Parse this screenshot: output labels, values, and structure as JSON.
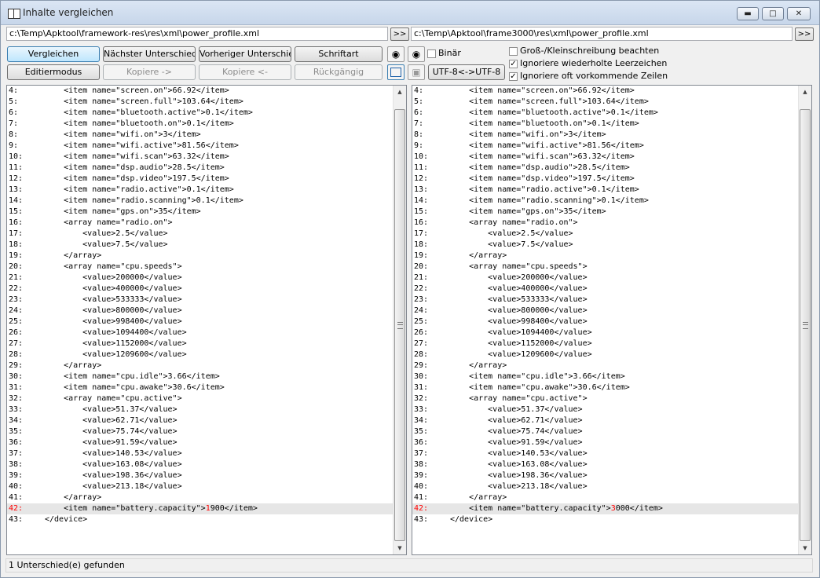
{
  "window": {
    "title": "Inhalte vergleichen"
  },
  "paths": {
    "left": "c:\\Temp\\Apktool\\framework-res\\res\\xml\\power_profile.xml",
    "right": "c:\\Temp\\Apktool\\frame3000\\res\\xml\\power_profile.xml",
    "browse_label": ">>"
  },
  "toolbar": {
    "compare": "Vergleichen",
    "next_diff": "Nächster Unterschied",
    "prev_diff": "Vorheriger Unterschied",
    "font": "Schriftart",
    "edit_mode": "Editiermodus",
    "copy_right": "Kopiere ->",
    "copy_left": "Kopiere <-",
    "undo": "Rückgängig",
    "encoding": "UTF-8<->UTF-8",
    "binary": "Binär",
    "case_sensitive": "Groß-/Kleinschreibung beachten",
    "ignore_repeated_spaces": "Ignoriere wiederholte Leerzeichen",
    "ignore_frequent_lines": "Ignoriere oft vorkommende Zeilen"
  },
  "options": {
    "binary": false,
    "case_sensitive": false,
    "ignore_repeated_spaces": true,
    "ignore_frequent_lines": true
  },
  "left_lines": [
    {
      "n": "4:",
      "t": "    <item name=\"screen.on\">66.92</item>"
    },
    {
      "n": "5:",
      "t": "    <item name=\"screen.full\">103.64</item>"
    },
    {
      "n": "6:",
      "t": "    <item name=\"bluetooth.active\">0.1</item>"
    },
    {
      "n": "7:",
      "t": "    <item name=\"bluetooth.on\">0.1</item>"
    },
    {
      "n": "8:",
      "t": "    <item name=\"wifi.on\">3</item>"
    },
    {
      "n": "9:",
      "t": "    <item name=\"wifi.active\">81.56</item>"
    },
    {
      "n": "10:",
      "t": "    <item name=\"wifi.scan\">63.32</item>"
    },
    {
      "n": "11:",
      "t": "    <item name=\"dsp.audio\">28.5</item>"
    },
    {
      "n": "12:",
      "t": "    <item name=\"dsp.video\">197.5</item>"
    },
    {
      "n": "13:",
      "t": "    <item name=\"radio.active\">0.1</item>"
    },
    {
      "n": "14:",
      "t": "    <item name=\"radio.scanning\">0.1</item>"
    },
    {
      "n": "15:",
      "t": "    <item name=\"gps.on\">35</item>"
    },
    {
      "n": "16:",
      "t": "    <array name=\"radio.on\">"
    },
    {
      "n": "17:",
      "t": "        <value>2.5</value>"
    },
    {
      "n": "18:",
      "t": "        <value>7.5</value>"
    },
    {
      "n": "19:",
      "t": "    </array>"
    },
    {
      "n": "20:",
      "t": "    <array name=\"cpu.speeds\">"
    },
    {
      "n": "21:",
      "t": "        <value>200000</value>"
    },
    {
      "n": "22:",
      "t": "        <value>400000</value>"
    },
    {
      "n": "23:",
      "t": "        <value>533333</value>"
    },
    {
      "n": "24:",
      "t": "        <value>800000</value>"
    },
    {
      "n": "25:",
      "t": "        <value>998400</value>"
    },
    {
      "n": "26:",
      "t": "        <value>1094400</value>"
    },
    {
      "n": "27:",
      "t": "        <value>1152000</value>"
    },
    {
      "n": "28:",
      "t": "        <value>1209600</value>"
    },
    {
      "n": "29:",
      "t": "    </array>"
    },
    {
      "n": "30:",
      "t": "    <item name=\"cpu.idle\">3.66</item>"
    },
    {
      "n": "31:",
      "t": "    <item name=\"cpu.awake\">30.6</item>"
    },
    {
      "n": "32:",
      "t": "    <array name=\"cpu.active\">"
    },
    {
      "n": "33:",
      "t": "        <value>51.37</value>"
    },
    {
      "n": "34:",
      "t": "        <value>62.71</value>"
    },
    {
      "n": "35:",
      "t": "        <value>75.74</value>"
    },
    {
      "n": "36:",
      "t": "        <value>91.59</value>"
    },
    {
      "n": "37:",
      "t": "        <value>140.53</value>"
    },
    {
      "n": "38:",
      "t": "        <value>163.08</value>"
    },
    {
      "n": "39:",
      "t": "        <value>198.36</value>"
    },
    {
      "n": "40:",
      "t": "        <value>213.18</value>"
    },
    {
      "n": "41:",
      "t": "    </array>"
    },
    {
      "n": "42:",
      "t": "    <item name=\"battery.capacity\">",
      "d": "1",
      "r": "900</item>",
      "hl": true
    },
    {
      "n": "43:",
      "t": "</device>"
    }
  ],
  "right_lines": [
    {
      "n": "4:",
      "t": "    <item name=\"screen.on\">66.92</item>"
    },
    {
      "n": "5:",
      "t": "    <item name=\"screen.full\">103.64</item>"
    },
    {
      "n": "6:",
      "t": "    <item name=\"bluetooth.active\">0.1</item>"
    },
    {
      "n": "7:",
      "t": "    <item name=\"bluetooth.on\">0.1</item>"
    },
    {
      "n": "8:",
      "t": "    <item name=\"wifi.on\">3</item>"
    },
    {
      "n": "9:",
      "t": "    <item name=\"wifi.active\">81.56</item>"
    },
    {
      "n": "10:",
      "t": "    <item name=\"wifi.scan\">63.32</item>"
    },
    {
      "n": "11:",
      "t": "    <item name=\"dsp.audio\">28.5</item>"
    },
    {
      "n": "12:",
      "t": "    <item name=\"dsp.video\">197.5</item>"
    },
    {
      "n": "13:",
      "t": "    <item name=\"radio.active\">0.1</item>"
    },
    {
      "n": "14:",
      "t": "    <item name=\"radio.scanning\">0.1</item>"
    },
    {
      "n": "15:",
      "t": "    <item name=\"gps.on\">35</item>"
    },
    {
      "n": "16:",
      "t": "    <array name=\"radio.on\">"
    },
    {
      "n": "17:",
      "t": "        <value>2.5</value>"
    },
    {
      "n": "18:",
      "t": "        <value>7.5</value>"
    },
    {
      "n": "19:",
      "t": "    </array>"
    },
    {
      "n": "20:",
      "t": "    <array name=\"cpu.speeds\">"
    },
    {
      "n": "21:",
      "t": "        <value>200000</value>"
    },
    {
      "n": "22:",
      "t": "        <value>400000</value>"
    },
    {
      "n": "23:",
      "t": "        <value>533333</value>"
    },
    {
      "n": "24:",
      "t": "        <value>800000</value>"
    },
    {
      "n": "25:",
      "t": "        <value>998400</value>"
    },
    {
      "n": "26:",
      "t": "        <value>1094400</value>"
    },
    {
      "n": "27:",
      "t": "        <value>1152000</value>"
    },
    {
      "n": "28:",
      "t": "        <value>1209600</value>"
    },
    {
      "n": "29:",
      "t": "    </array>"
    },
    {
      "n": "30:",
      "t": "    <item name=\"cpu.idle\">3.66</item>"
    },
    {
      "n": "31:",
      "t": "    <item name=\"cpu.awake\">30.6</item>"
    },
    {
      "n": "32:",
      "t": "    <array name=\"cpu.active\">"
    },
    {
      "n": "33:",
      "t": "        <value>51.37</value>"
    },
    {
      "n": "34:",
      "t": "        <value>62.71</value>"
    },
    {
      "n": "35:",
      "t": "        <value>75.74</value>"
    },
    {
      "n": "36:",
      "t": "        <value>91.59</value>"
    },
    {
      "n": "37:",
      "t": "        <value>140.53</value>"
    },
    {
      "n": "38:",
      "t": "        <value>163.08</value>"
    },
    {
      "n": "39:",
      "t": "        <value>198.36</value>"
    },
    {
      "n": "40:",
      "t": "        <value>213.18</value>"
    },
    {
      "n": "41:",
      "t": "    </array>"
    },
    {
      "n": "42:",
      "t": "    <item name=\"battery.capacity\">",
      "d": "3",
      "r": "000</item>",
      "hl": true
    },
    {
      "n": "43:",
      "t": "</device>"
    }
  ],
  "status": "1 Unterschied(e) gefunden"
}
